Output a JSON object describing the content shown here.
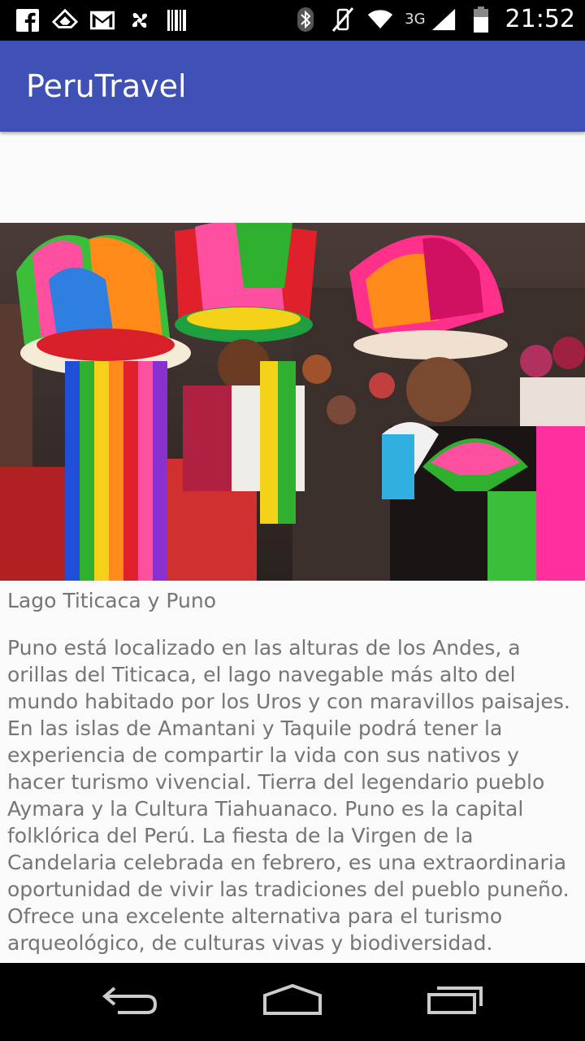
{
  "status_bar": {
    "time": "21:52",
    "network": "3G",
    "left_icons": [
      "facebook-icon",
      "feedly-icon",
      "gmail-icon",
      "pinwheel-icon",
      "barcode-icon"
    ],
    "right_icons": [
      "bluetooth-icon",
      "vibrate-off-icon",
      "wifi-icon",
      "signal-icon",
      "battery-icon"
    ]
  },
  "app_bar": {
    "title": "PeruTravel"
  },
  "destination": {
    "title": "Lago Titicaca y Puno",
    "description": "Puno está localizado en las alturas de los Andes, a orillas del Titicaca, el lago navegable más alto del mundo habitado por los Uros y con maravillos paisajes. En las islas de Amantani y Taquile podrá tener la experiencia de compartir la vida con sus nativos y hacer turismo vivencial. Tierra del legendario pueblo Aymara y la Cultura Tiahuanaco. Puno es la capital folklórica del Perú. La fiesta de la Virgen de la Candelaria celebrada en febrero, es una extraordinaria oportunidad de vivir las tradiciones del pueblo puneño. Ofrece una excelente alternativa para el turismo arqueológico, de culturas vivas y biodiversidad."
  },
  "nav_bar": {
    "buttons": [
      "back-icon",
      "home-icon",
      "recents-icon"
    ]
  }
}
